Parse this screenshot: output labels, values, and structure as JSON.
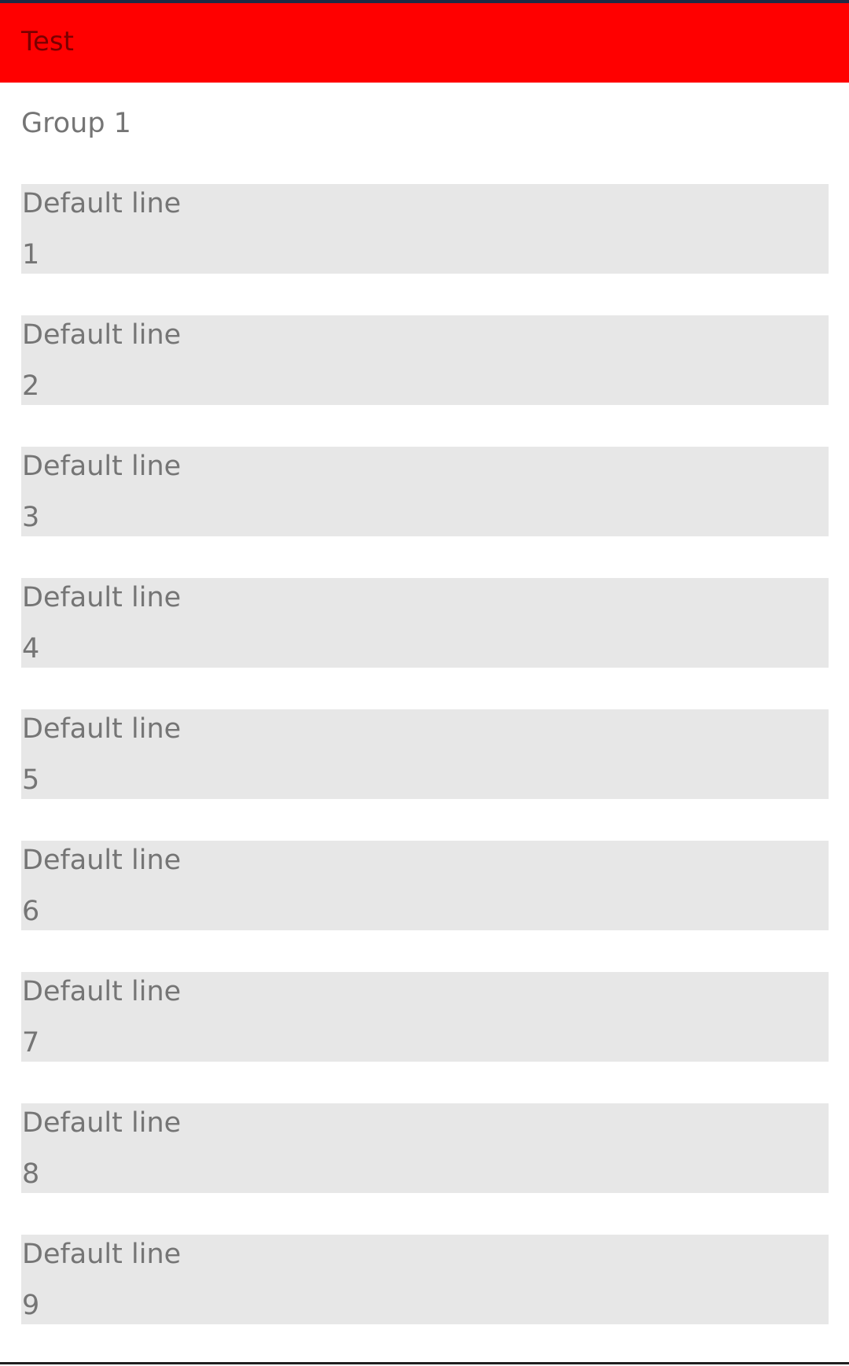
{
  "toolbar": {
    "title": "Test",
    "background_color": "#ff0000"
  },
  "group": {
    "title": "Group 1"
  },
  "items": [
    {
      "label": "Default line",
      "number": "1"
    },
    {
      "label": "Default line",
      "number": "2"
    },
    {
      "label": "Default line",
      "number": "3"
    },
    {
      "label": "Default line",
      "number": "4"
    },
    {
      "label": "Default line",
      "number": "5"
    },
    {
      "label": "Default line",
      "number": "6"
    },
    {
      "label": "Default line",
      "number": "7"
    },
    {
      "label": "Default line",
      "number": "8"
    },
    {
      "label": "Default line",
      "number": "9"
    }
  ]
}
